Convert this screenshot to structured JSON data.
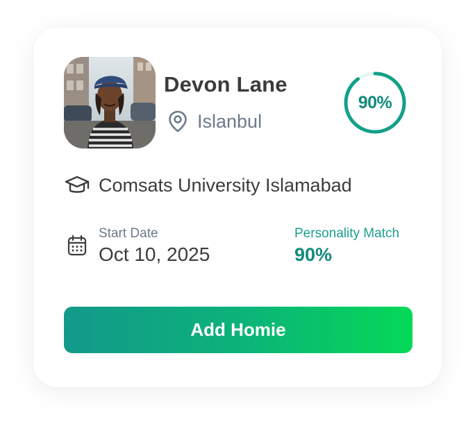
{
  "profile": {
    "name": "Devon Lane",
    "location": "Islanbul",
    "match_badge": "90%",
    "match_fraction": 0.9
  },
  "education": {
    "school": "Comsats University Islamabad"
  },
  "details": {
    "start_label": "Start Date",
    "start_value": "Oct 10, 2025",
    "match_label": "Personality Match",
    "match_value": "90%"
  },
  "actions": {
    "add_label": "Add Homie"
  },
  "colors": {
    "accent": "#13998a",
    "accent_end": "#04d957",
    "ring_track": "#e6f7f3",
    "text_dark": "#3c3c3c",
    "text_muted": "#6b7a8c"
  },
  "icons": {
    "location": "map-pin-icon",
    "school": "graduation-cap-icon",
    "date": "calendar-icon"
  }
}
